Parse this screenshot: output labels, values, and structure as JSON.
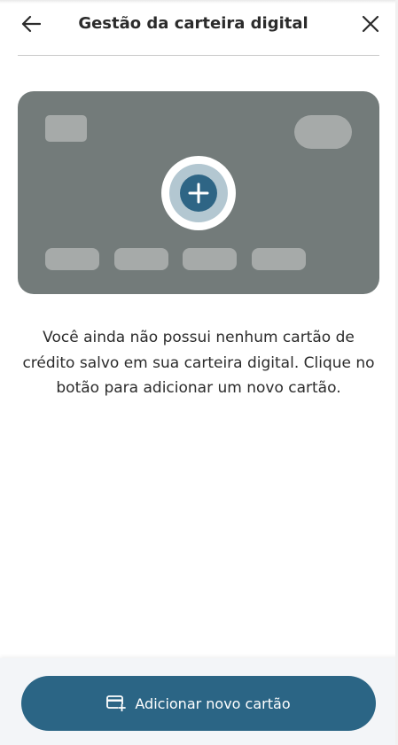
{
  "header": {
    "title": "Gestão da carteira digital",
    "back_icon": "arrow-left-icon",
    "close_icon": "close-icon"
  },
  "card_placeholder": {
    "add_icon": "plus-circle-icon"
  },
  "empty_state": {
    "message": "Você ainda não possui nenhum cartão de crédito salvo em sua carteira digital. Clique no botão para adicionar um novo cartão."
  },
  "footer": {
    "add_button_label": "Adicionar novo cartão",
    "add_button_icon": "credit-card-plus-icon"
  },
  "colors": {
    "primary": "#2b6585",
    "card_bg": "#737b7a",
    "card_shapes": "#a6aaa9"
  }
}
